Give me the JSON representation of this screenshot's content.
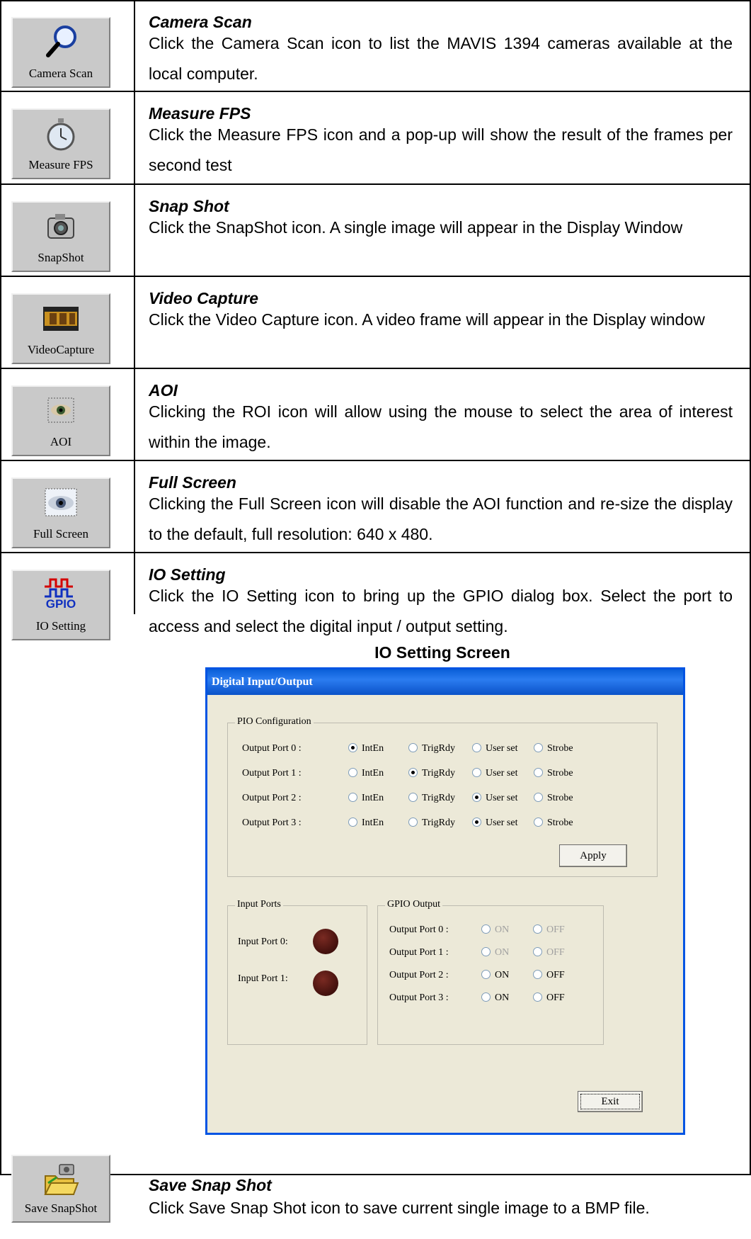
{
  "rows": [
    {
      "icon_label": "Camera Scan",
      "icon": "magnifier-icon",
      "title": "Camera Scan",
      "desc": "Click the Camera Scan icon to list the MAVIS 1394 cameras available at the local computer."
    },
    {
      "icon_label": "Measure FPS",
      "icon": "stopwatch-icon",
      "title": "Measure FPS",
      "desc": "Click the Measure FPS icon and a pop-up will show the result of the frames per second test"
    },
    {
      "icon_label": "SnapShot",
      "icon": "camera-icon",
      "title": "Snap Shot",
      "desc": "Click the SnapShot icon. A single image will appear in the Display Window"
    },
    {
      "icon_label": "VideoCapture",
      "icon": "film-icon",
      "title": "Video Capture",
      "desc": "Click the Video Capture icon. A video frame will appear in the Display window"
    },
    {
      "icon_label": "AOI",
      "icon": "aoi-eye-icon",
      "title": "AOI",
      "desc": "Clicking the ROI icon will allow using the mouse to select the area of interest within the image."
    },
    {
      "icon_label": "Full Screen",
      "icon": "fullscreen-eye-icon",
      "title": "Full Screen",
      "desc": "Clicking the Full Screen icon will disable the AOI function and re-size the display to the default, full resolution: 640 x 480."
    },
    {
      "icon_label": "IO Setting",
      "icon": "gpio-icon",
      "icon_text": "GPIO",
      "title": "IO Setting",
      "desc": "Click the IO Setting icon to bring up the GPIO dialog box. Select the port to access and select the digital input / output setting."
    },
    {
      "icon_label": "Save SnapShot",
      "icon": "folder-camera-icon",
      "title": "Save Snap Shot",
      "desc": "Click Save Snap Shot icon to save current single image to a BMP file."
    }
  ],
  "figure_caption": "IO Setting Screen",
  "dialog": {
    "title": "Digital Input/Output",
    "pio": {
      "group_title": "PIO Configuration",
      "options": [
        "IntEn",
        "TrigRdy",
        "User set",
        "Strobe"
      ],
      "ports": [
        {
          "label": "Output Port 0 :",
          "selected": "IntEn"
        },
        {
          "label": "Output Port 1 :",
          "selected": "TrigRdy"
        },
        {
          "label": "Output Port 2 :",
          "selected": "User set"
        },
        {
          "label": "Output Port 3 :",
          "selected": "User set"
        }
      ],
      "apply_label": "Apply"
    },
    "input": {
      "group_title": "Input Ports",
      "ports": [
        "Input Port 0:",
        "Input Port 1:"
      ]
    },
    "gpio": {
      "group_title": "GPIO Output",
      "on_label": "ON",
      "off_label": "OFF",
      "ports": [
        {
          "label": "Output Port 0 :",
          "enabled": false
        },
        {
          "label": "Output Port 1 :",
          "enabled": false
        },
        {
          "label": "Output Port 2 :",
          "enabled": true
        },
        {
          "label": "Output Port 3 :",
          "enabled": true
        }
      ]
    },
    "exit_label": "Exit"
  },
  "colors": {
    "titlebar": "#0a5fd8",
    "dialog_bg": "#ece9d8",
    "led": "#5a1a14",
    "gpio_red": "#d40000",
    "gpio_blue": "#1030c0"
  }
}
